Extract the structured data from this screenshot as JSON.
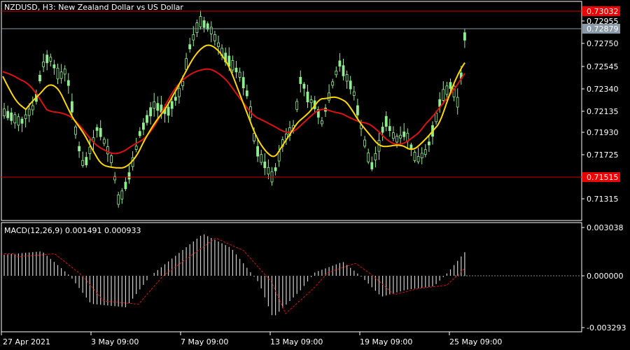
{
  "main": {
    "symbol_title": "NZDUSD, H3:  New Zealand Dollar vs US Dollar",
    "price_labels": [
      "0.72955",
      "0.72750",
      "0.72545",
      "0.72340",
      "0.72135",
      "0.71930",
      "0.71725",
      "0.71315"
    ],
    "resistance_label": "0.73032",
    "support_label": "0.71515",
    "bid_label": "0.72879",
    "colors": {
      "candle": "#90ee90",
      "fast_ma": "#ffd700",
      "slow_ma": "#dd1111",
      "level": "#cc0000",
      "bid_line": "#8a9aa8",
      "bid_label_bg": "#8a9aa8",
      "level_label_bg": "#ee0000"
    }
  },
  "macd": {
    "title": "MACD(12,26,9) 0.001491 0.000933",
    "labels": [
      "0.003038",
      "0.000000",
      "-0.003293"
    ]
  },
  "time_axis": {
    "labels": [
      "27 Apr 2021",
      "3 May 09:00",
      "7 May 09:00",
      "13 May 09:00",
      "19 May 09:00",
      "25 May 09:00"
    ]
  },
  "chart_data": [
    {
      "type": "candlestick",
      "title": "NZDUSD, H3:  New Zealand Dollar vs US Dollar",
      "ylim": [
        0.7122,
        0.7318
      ],
      "horizontal_levels": [
        0.73032,
        0.71515
      ],
      "current_price": 0.72879,
      "series": [
        {
          "name": "",
          "kind": "moving_average_fast",
          "color": "#ffd700"
        },
        {
          "name": "",
          "kind": "moving_average_slow",
          "color": "#dd1111"
        }
      ]
    },
    {
      "type": "bar",
      "title": "MACD(12,26,9) 0.001491 0.000933",
      "ylim": [
        -0.003293,
        0.003038
      ],
      "macd": 0.001491,
      "signal": 0.000933
    }
  ]
}
